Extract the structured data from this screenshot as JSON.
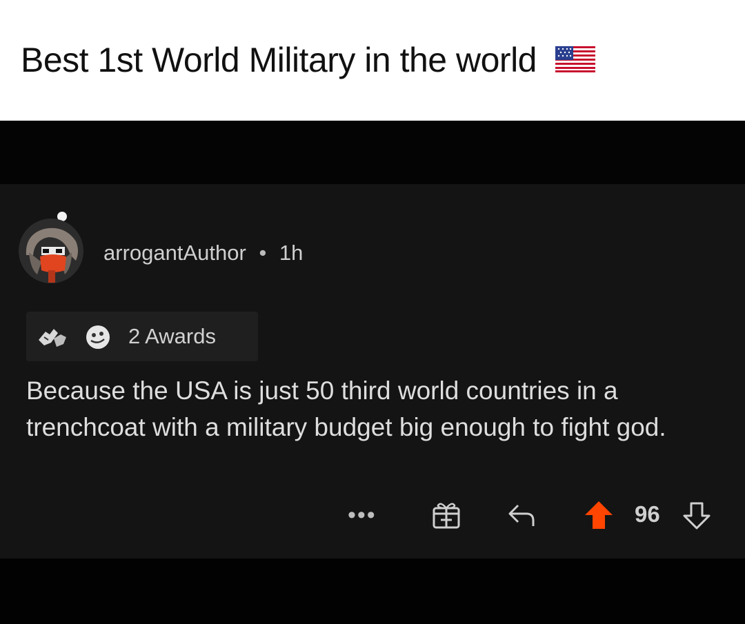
{
  "caption": {
    "text": "Best 1st World Military in the world",
    "flag_icon": "us-flag-icon"
  },
  "comment": {
    "author": "arrogantAuthor",
    "separator": "•",
    "time": "1h",
    "awards_label": "2 Awards",
    "body": "Because the USA is just 50 third world countries in a trenchcoat with a military budget big enough to fight god.",
    "actions": {
      "more_label": "•••",
      "vote_count": "96"
    }
  },
  "colors": {
    "upvote": "#ff4500",
    "background": "#141414",
    "text": "#dedede"
  },
  "icons": [
    "us-flag-icon",
    "avatar",
    "award-hands-icon",
    "award-face-icon",
    "gift-icon",
    "reply-icon",
    "upvote-icon",
    "downvote-icon"
  ]
}
